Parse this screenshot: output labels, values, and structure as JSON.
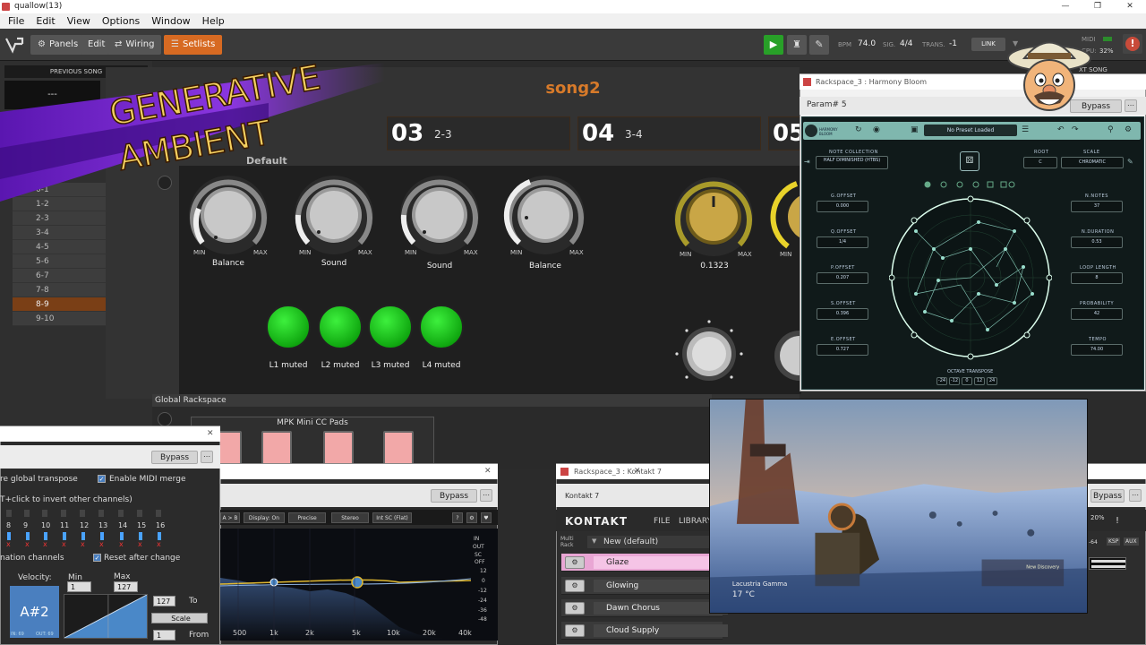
{
  "window": {
    "title": "quallow(13)"
  },
  "menu": [
    "File",
    "Edit",
    "View",
    "Options",
    "Window",
    "Help"
  ],
  "toolbar": {
    "panels": "Panels",
    "edit": "Edit",
    "wiring": "Wiring",
    "setlists": "Setlists",
    "bpm_label": "BPM",
    "bpm": "74.0",
    "sig_label": "SIG.",
    "sig": "4/4",
    "trans_label": "TRANS.",
    "trans": "-1",
    "link": "LINK",
    "midi_label": "MIDI",
    "cpu_label": "CPU:",
    "cpu": "32%"
  },
  "left": {
    "previous_song_label": "PREVIOUS SONG",
    "previous_song": "---",
    "songs": [
      "0-1",
      "1-2",
      "2-3",
      "3-4",
      "4-5",
      "5-6",
      "6-7",
      "7-8",
      "8-9",
      "9-10"
    ],
    "selected_index": 8
  },
  "banner": {
    "line1": "GENERATIVE",
    "line2": "AMBIENT"
  },
  "main": {
    "song_title": "song2",
    "rack_name": "Default",
    "next_song_label": "XT SONG",
    "parts": [
      {
        "num": "03",
        "name": "2-3"
      },
      {
        "num": "04",
        "name": "3-4"
      },
      {
        "num": "05",
        "name": ""
      }
    ],
    "knobs": [
      {
        "label": "Balance",
        "min": "MIN",
        "max": "MAX"
      },
      {
        "label": "Sound",
        "min": "MIN",
        "max": "MAX"
      },
      {
        "label": "Sound",
        "min": "MIN",
        "max": "MAX"
      },
      {
        "label": "Balance",
        "min": "MIN",
        "max": "MAX"
      },
      {
        "label": "0.1323",
        "min": "MIN",
        "max": "MAX"
      },
      {
        "label": "",
        "min": "MIN",
        "max": ""
      }
    ],
    "mutes": [
      "L1 muted",
      "L2 muted",
      "L3 muted",
      "L4 muted"
    ],
    "global_rackspace": "Global Rackspace",
    "pads_title": "MPK Mini CC Pads"
  },
  "harmony": {
    "title": "Rackspace_3 : Harmony Bloom",
    "param": "Param# 5",
    "bypass": "Bypass",
    "logo": "HARMONY BLOOM",
    "preset": "No Preset Loaded",
    "note_collection_label": "NOTE COLLECTION",
    "note_collection": "HALF DIMINISHED (HTBS)",
    "root_label": "ROOT",
    "root": "C",
    "scale_label": "SCALE",
    "scale": "CHROMATIC",
    "left_params": [
      {
        "label": "G.OFFSET",
        "value": "0.000"
      },
      {
        "label": "Q.OFFSET",
        "value": "1/4"
      },
      {
        "label": "P.OFFSET",
        "value": "0.207"
      },
      {
        "label": "S.OFFSET",
        "value": "0.396"
      },
      {
        "label": "E.OFFSET",
        "value": "0.727"
      }
    ],
    "right_params": [
      {
        "label": "N.NOTES",
        "value": "37"
      },
      {
        "label": "N.DURATION",
        "value": "0.53"
      },
      {
        "label": "LOOP LENGTH",
        "value": "8"
      },
      {
        "label": "PROBABILITY",
        "value": "42"
      },
      {
        "label": "TEMPO",
        "value": "74.00"
      }
    ],
    "octave_label": "OCTAVE TRANSPOSE",
    "octaves": [
      "-24",
      "-12",
      "0",
      "12",
      "24"
    ]
  },
  "midi": {
    "bypass": "Bypass",
    "ignore_transpose": "re global transpose",
    "enable_merge": "Enable MIDI merge",
    "invert_hint": "T+click to invert other channels)",
    "channels": [
      "8",
      "9",
      "10",
      "11",
      "12",
      "13",
      "14",
      "15",
      "16"
    ],
    "nation_channels": "nation channels",
    "reset_after": "Reset after change",
    "velocity": "Velocity:",
    "min_label": "Min",
    "max_label": "Max",
    "min_value": "1",
    "max_value": "127",
    "note": "A#2",
    "in_label": "IN: 69",
    "out_label": "OUT: 69",
    "to_value": "127",
    "to_label": "To",
    "scale": "Scale",
    "from_value": "1",
    "from_label": "From"
  },
  "eq": {
    "bypass": "Bypass",
    "buttons": [
      "A > B",
      "Display: On",
      "Precise",
      "Stereo",
      "Int SC (Flat)"
    ],
    "help": "?",
    "right_labels": [
      "IN",
      "OUT",
      "SC",
      "OFF"
    ],
    "db_ticks": [
      "12",
      "0",
      "-12",
      "-24",
      "-36",
      "-48"
    ],
    "freq_ticks": [
      "500",
      "1k",
      "2k",
      "5k",
      "10k",
      "20k",
      "40k"
    ]
  },
  "kontakt": {
    "title": "Rackspace_3 : Kontakt 7",
    "sub": "Kontakt 7",
    "logo": "KONTAKT",
    "file": "FILE",
    "library": "LIBRARY",
    "multi_rack": "Multi Rack",
    "multi_name": "New (default)",
    "instruments": [
      "Glaze",
      "Glowing",
      "Dawn Chorus",
      "Cloud Supply"
    ],
    "bypass": "Bypass",
    "readout": "20%",
    "ksp": "KSP",
    "aux": "AUX",
    "val64": "-64"
  },
  "game": {
    "caption": "Lacustria Gamma",
    "temp": "17 °C",
    "toast_title": "New Discovery"
  },
  "colors": {
    "accent": "#d76a22",
    "green": "#28a028",
    "banner_purple": "#7b2bd6",
    "harmony_teal": "#7fb7ae"
  }
}
